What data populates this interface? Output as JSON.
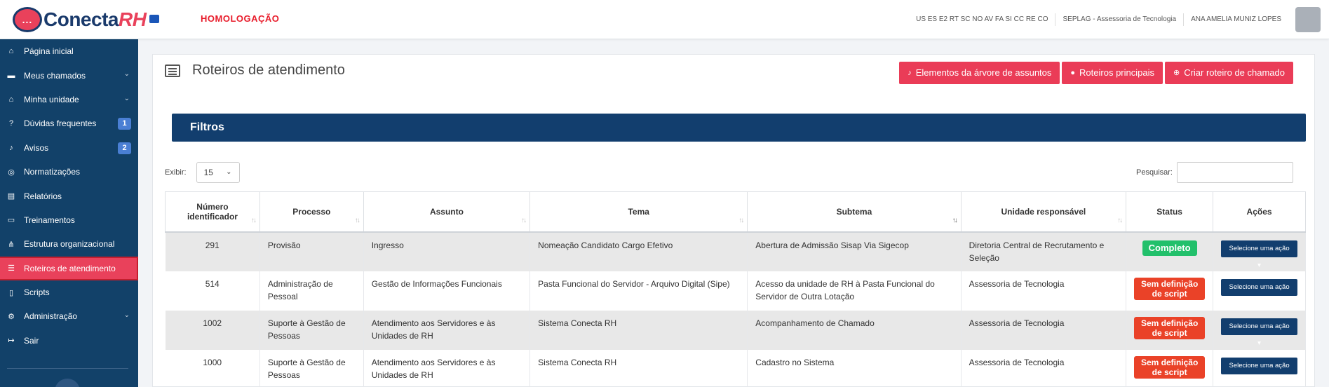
{
  "header": {
    "logo_mark": "...",
    "logo_name": "Conecta",
    "logo_suffix": "RH",
    "environment": "HOMOLOGAÇÃO",
    "units": "US ES E2 RT SC NO AV FA SI CC RE CO",
    "org": "SEPLAG - Assessoria de Tecnologia",
    "user": "ANA AMELIA MUNIZ LOPES"
  },
  "sidebar": {
    "items": [
      {
        "label": "Página inicial",
        "icon": "home-icon"
      },
      {
        "label": "Meus chamados",
        "icon": "inbox-icon"
      },
      {
        "label": "Minha unidade",
        "icon": "building-icon"
      },
      {
        "label": "Dúvidas frequentes",
        "icon": "question-icon",
        "badge": "1"
      },
      {
        "label": "Avisos",
        "icon": "bell-icon",
        "badge": "2"
      },
      {
        "label": "Normatizações",
        "icon": "compass-icon"
      },
      {
        "label": "Relatórios",
        "icon": "chart-icon"
      },
      {
        "label": "Treinamentos",
        "icon": "chalkboard-icon"
      },
      {
        "label": "Estrutura organizacional",
        "icon": "sitemap-icon"
      },
      {
        "label": "Roteiros de atendimento",
        "icon": "list-icon"
      },
      {
        "label": "Scripts",
        "icon": "file-icon"
      },
      {
        "label": "Administração",
        "icon": "cogs-icon"
      },
      {
        "label": "Sair",
        "icon": "signout-icon"
      }
    ]
  },
  "page": {
    "title": "Roteiros de atendimento",
    "buttons": {
      "tree": "Elementos da árvore de assuntos",
      "main": "Roteiros principais",
      "create": "Criar roteiro de chamado"
    },
    "filters_title": "Filtros",
    "show_label": "Exibir:",
    "show_value": "15",
    "search_label": "Pesquisar:",
    "search_value": ""
  },
  "table": {
    "headers": [
      "Número identificador",
      "Processo",
      "Assunto",
      "Tema",
      "Subtema",
      "Unidade responsável",
      "Status",
      "Ações"
    ],
    "action_label": "Selecione uma ação",
    "rows": [
      {
        "id": "291",
        "processo": "Provisão",
        "assunto": "Ingresso",
        "tema": "Nomeação Candidato Cargo Efetivo",
        "subtema": "Abertura de Admissão Sisap Via Sigecop",
        "unidade": "Diretoria Central de Recrutamento e Seleção",
        "status": "Completo"
      },
      {
        "id": "514",
        "processo": "Administração de Pessoal",
        "assunto": "Gestão de Informações Funcionais",
        "tema": "Pasta Funcional do Servidor - Arquivo Digital (Sipe)",
        "subtema": "Acesso da unidade de RH à Pasta Funcional do Servidor de Outra Lotação",
        "unidade": "Assessoria de Tecnologia",
        "status": "Sem definição de script"
      },
      {
        "id": "1002",
        "processo": "Suporte à Gestão de Pessoas",
        "assunto": "Atendimento aos Servidores e às Unidades de RH",
        "tema": "Sistema Conecta RH",
        "subtema": "Acompanhamento de Chamado",
        "unidade": "Assessoria de Tecnologia",
        "status": "Sem definição de script"
      },
      {
        "id": "1000",
        "processo": "Suporte à Gestão de Pessoas",
        "assunto": "Atendimento aos Servidores e às Unidades de RH",
        "tema": "Sistema Conecta RH",
        "subtema": "Cadastro no Sistema",
        "unidade": "Assessoria de Tecnologia",
        "status": "Sem definição de script"
      }
    ]
  },
  "colors": {
    "brand_navy": "#124169",
    "brand_red": "#e9415b",
    "status_ok": "#22c06b",
    "status_missing": "#ea4228"
  }
}
